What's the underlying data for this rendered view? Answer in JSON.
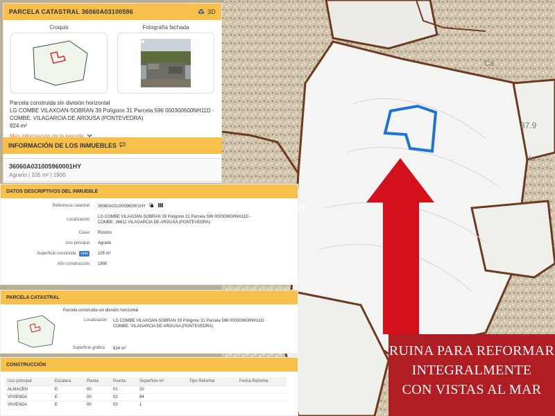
{
  "parcel": {
    "header": "PARCELA CATASTRAL 36060A03100596",
    "btn_3d": "3D",
    "croquis_label": "Croquis",
    "photo_label": "Fotografía fachada",
    "description": "Parcela construida sin división horizontal",
    "address_line1": "LG COMBE VILAXOAN-SOBRAN 39 Polígono 31 Parcela 596 000300600NH11D -",
    "address_line2": "COMBE. VILAGARCIA DE AROUSA (PONTEVEDRA)",
    "area": "824 m²",
    "more_info": "Más información de la parcela"
  },
  "inmuebles": {
    "header": "INFORMACIÓN DE LOS INMUEBLES",
    "ref": "36060A031005960001HY",
    "subtitle": "Agrario | 105 m² | 1900"
  },
  "datos": {
    "header": "DATOS DESCRIPTIVOS DEL INMUEBLE",
    "rows": [
      {
        "k": "Referencia catastral",
        "v": "36060A031005960001HY"
      },
      {
        "k": "Localización",
        "v": "LG COMBE VILAXOAN-SOBRAN 39 Polígono 31 Parcela 596 000300600NH11D - COMBE. 36611 VILAGARCIA DE AROUSA (PONTEVEDRA)"
      },
      {
        "k": "Clase",
        "v": "Rústico"
      },
      {
        "k": "Uso principal",
        "v": "Agrario"
      },
      {
        "k": "Superficie construida",
        "v": "105 m²",
        "btn": "+info"
      },
      {
        "k": "Año construcción",
        "v": "1900"
      }
    ]
  },
  "parcela2": {
    "header": "PARCELA CATASTRAL",
    "desc": "Parcela construida sin división horizontal",
    "loc_k": "Localización",
    "loc_v": "LG COMBE VILAXOAN-SOBRAN 39 Polígono 31 Parcela 596 000300600NH11D - COMBE. VILAGARCIA DE AROUSA (PONTEVEDRA)",
    "sup_k": "Superficie gráfica",
    "sup_v": "824 m²"
  },
  "construccion": {
    "header": "CONSTRUCCIÓN",
    "columns": [
      "Uso principal",
      "Escalera",
      "Planta",
      "Puerta",
      "Superficie m²",
      "Tipo Reforma",
      "Fecha Reforma"
    ],
    "rows": [
      [
        "ALMACEN",
        "E",
        "00",
        "01",
        "20",
        "",
        ""
      ],
      [
        "VIVIENDA",
        "E",
        "00",
        "02",
        "84",
        "",
        ""
      ],
      [
        "VIVIENDA",
        "E",
        "00",
        "03",
        "1",
        "",
        ""
      ]
    ]
  },
  "map": {
    "label_1": "37.9",
    "label_2": "Ic",
    "label_3": "Ca"
  },
  "watermark": "habitaclia",
  "banner": {
    "line1": "RUINA PARA REFORMAR",
    "line2": "INTEGRALMENTE",
    "line3": "CON VISTAS AL MAR"
  },
  "colors": {
    "accent": "#f7c04a",
    "link": "#e0771c",
    "banner": "#b01d22",
    "arrow": "#d4101a",
    "parcel_outline": "#1a73d9",
    "map_boundary": "#6b3a1f"
  },
  "icons": [
    "cube-3d-icon",
    "chevron-down-icon",
    "speech-bubble-icon",
    "copy-icon",
    "map-icon",
    "expand-icon"
  ]
}
